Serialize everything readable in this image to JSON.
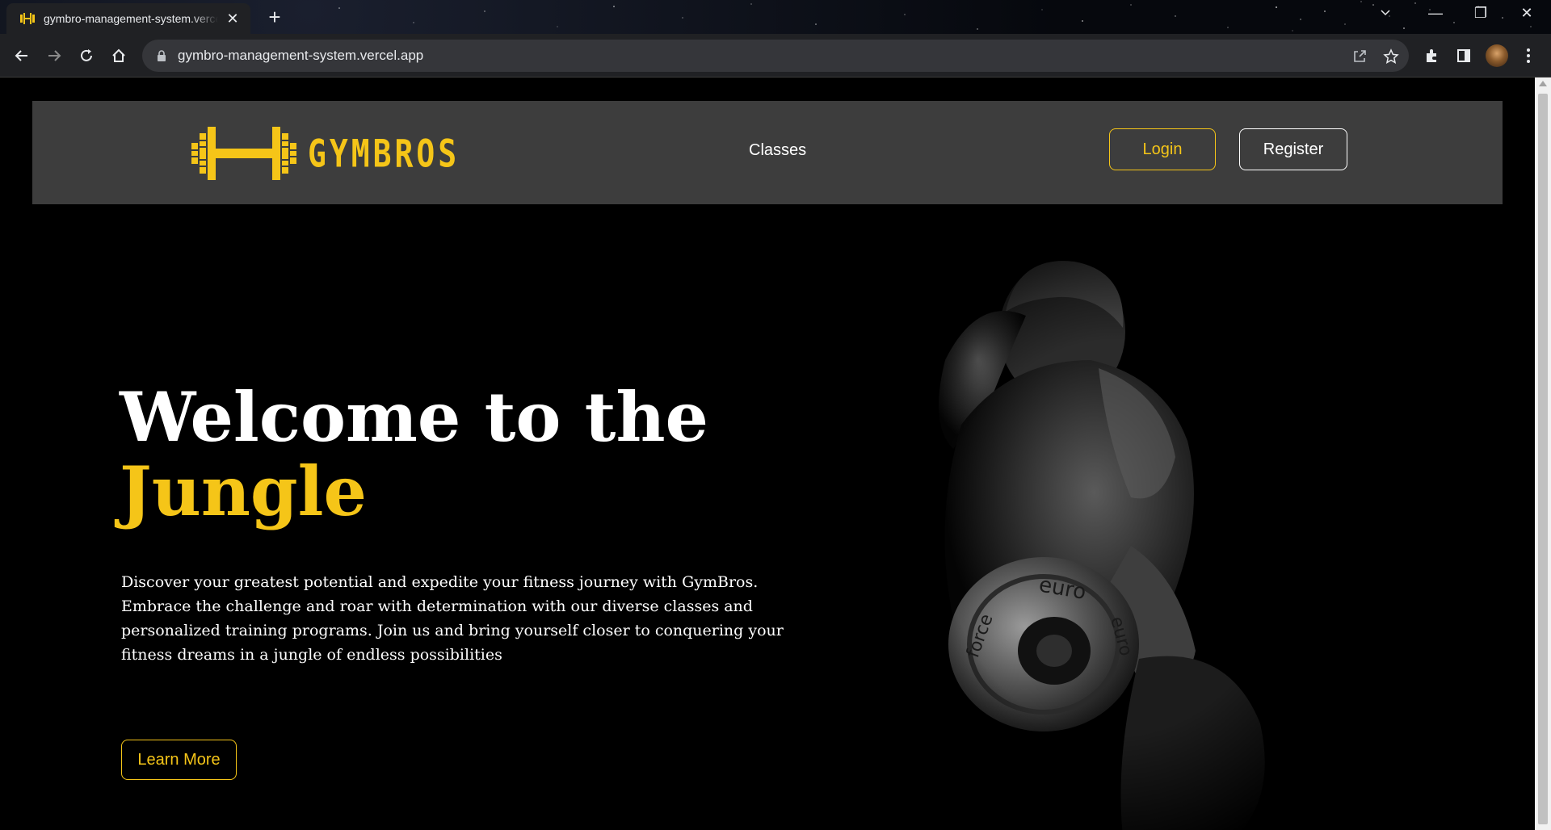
{
  "browser": {
    "tab_title": "gymbro-management-system.vercel.app",
    "url": "gymbro-management-system.vercel.app",
    "new_tab": "+",
    "tab_close": "✕",
    "window_controls": {
      "minimize": "—",
      "restore": "❐",
      "close": "✕"
    }
  },
  "navbar": {
    "logo_text": "GYMBROS",
    "links": {
      "classes": "Classes"
    },
    "login_label": "Login",
    "register_label": "Register"
  },
  "hero": {
    "title_line1": "Welcome to the",
    "title_accent": "Jungle",
    "description": "Discover your greatest potential and expedite your fitness journey with GymBros. Embrace the challenge and roar with determination with our diverse classes and personalized training programs. Join us and bring yourself closer to conquering your fitness dreams in a jungle of endless possibilities",
    "cta_label": "Learn More",
    "plate_text_top": "euro",
    "plate_text_left": "force",
    "plate_text_right": "euro"
  },
  "colors": {
    "accent": "#f5c518",
    "navbar_bg": "#3d3d3d",
    "page_bg": "#000000"
  },
  "icons": [
    "back-icon",
    "forward-icon",
    "reload-icon",
    "home-icon",
    "lock-icon",
    "share-icon",
    "star-icon",
    "extensions-icon",
    "side-panel-icon",
    "menu-icon",
    "dumbbell-logo"
  ]
}
